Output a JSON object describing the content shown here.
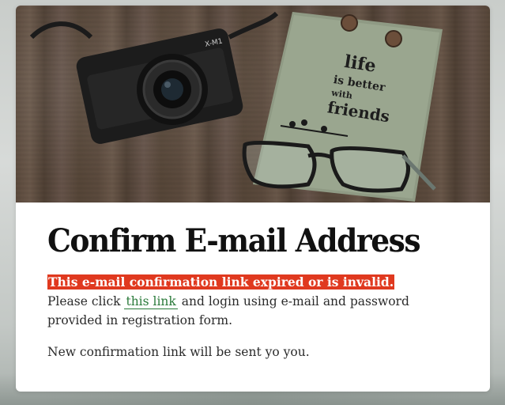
{
  "page": {
    "title": "Confirm E-mail Address",
    "error_text": "This e-mail confirmation link expired or is invalid.",
    "line_prefix": "Please click",
    "link_text": "this link",
    "line_suffix": "and login using e-mail and password provided in registration form.",
    "note": "New confirmation link will be sent yo you."
  },
  "hero": {
    "image": "camera-notebook-glasses-photo",
    "camera_brand": "X-M1",
    "notebook_text": [
      "life",
      "is better",
      "with",
      "friends"
    ]
  },
  "colors": {
    "error_bg": "#e0391f",
    "error_text": "#ffffff",
    "link": "#2a7a3a",
    "title": "#111111",
    "body_text": "#2b2b2b"
  }
}
